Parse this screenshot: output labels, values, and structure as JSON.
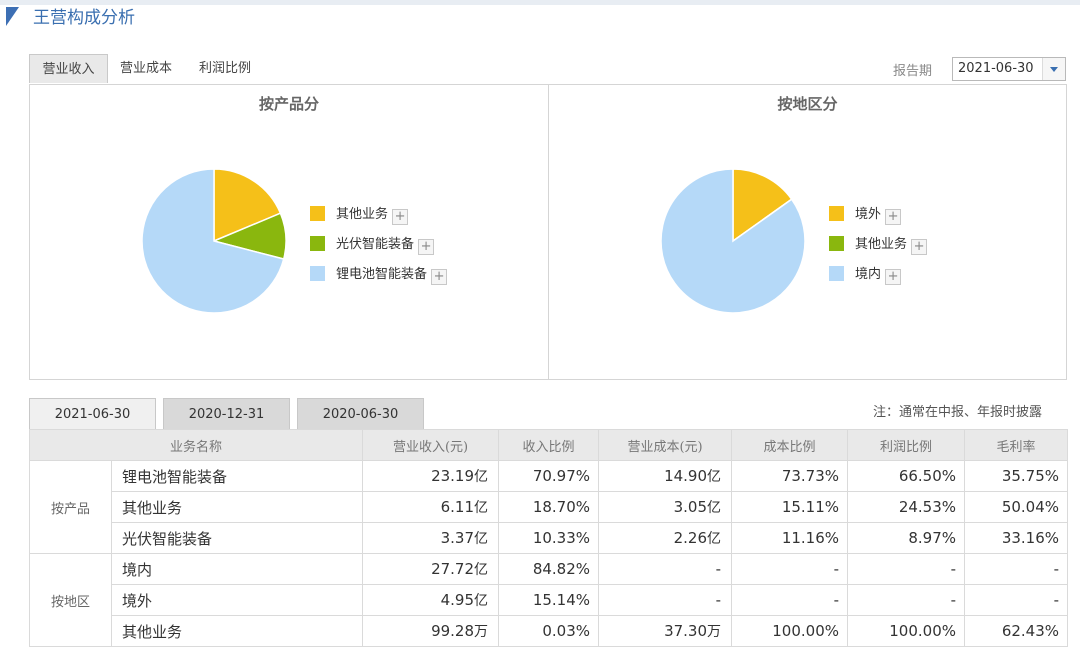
{
  "page_title": "王营构成分析",
  "tabs": [
    "营业收入",
    "营业成本",
    "利润比例"
  ],
  "report_period": {
    "label": "报告期",
    "value": "2021-06-30"
  },
  "chart_data": [
    {
      "type": "pie",
      "title": "按产品分",
      "labels": [
        "其他业务",
        "光伏智能装备",
        "锂电池智能装备"
      ],
      "values": [
        18.7,
        10.33,
        70.97
      ],
      "colors": [
        "#f5c019",
        "#8ab70e",
        "#b5d9f8"
      ]
    },
    {
      "type": "pie",
      "title": "按地区分",
      "labels": [
        "境外",
        "其他业务",
        "境内"
      ],
      "values": [
        15.14,
        0.03,
        84.82
      ],
      "colors": [
        "#f5c019",
        "#8ab70e",
        "#b5d9f8"
      ]
    }
  ],
  "period_tabs": [
    "2021-06-30",
    "2020-12-31",
    "2020-06-30"
  ],
  "note": "注：通常在中报、年报时披露",
  "table": {
    "headers": [
      "业务名称",
      "营业收入(元)",
      "收入比例",
      "营业成本(元)",
      "成本比例",
      "利润比例",
      "毛利率"
    ],
    "groups": [
      {
        "name": "按产品",
        "rows": [
          {
            "name": "锂电池智能装备",
            "rev": "23.19",
            "rev_u": "亿",
            "rev_pct": "70.97%",
            "cost": "14.90",
            "cost_u": "亿",
            "cost_pct": "73.73%",
            "profit_pct": "66.50%",
            "margin": "35.75%"
          },
          {
            "name": "其他业务",
            "rev": "6.11",
            "rev_u": "亿",
            "rev_pct": "18.70%",
            "cost": "3.05",
            "cost_u": "亿",
            "cost_pct": "15.11%",
            "profit_pct": "24.53%",
            "margin": "50.04%"
          },
          {
            "name": "光伏智能装备",
            "rev": "3.37",
            "rev_u": "亿",
            "rev_pct": "10.33%",
            "cost": "2.26",
            "cost_u": "亿",
            "cost_pct": "11.16%",
            "profit_pct": "8.97%",
            "margin": "33.16%"
          }
        ]
      },
      {
        "name": "按地区",
        "rows": [
          {
            "name": "境内",
            "rev": "27.72",
            "rev_u": "亿",
            "rev_pct": "84.82%",
            "cost": "-",
            "cost_u": "",
            "cost_pct": "-",
            "profit_pct": "-",
            "margin": "-"
          },
          {
            "name": "境外",
            "rev": "4.95",
            "rev_u": "亿",
            "rev_pct": "15.14%",
            "cost": "-",
            "cost_u": "",
            "cost_pct": "-",
            "profit_pct": "-",
            "margin": "-"
          },
          {
            "name": "其他业务",
            "rev": "99.28",
            "rev_u": "万",
            "rev_pct": "0.03%",
            "cost": "37.30",
            "cost_u": "万",
            "cost_pct": "100.00%",
            "profit_pct": "100.00%",
            "margin": "62.43%"
          }
        ]
      }
    ]
  }
}
